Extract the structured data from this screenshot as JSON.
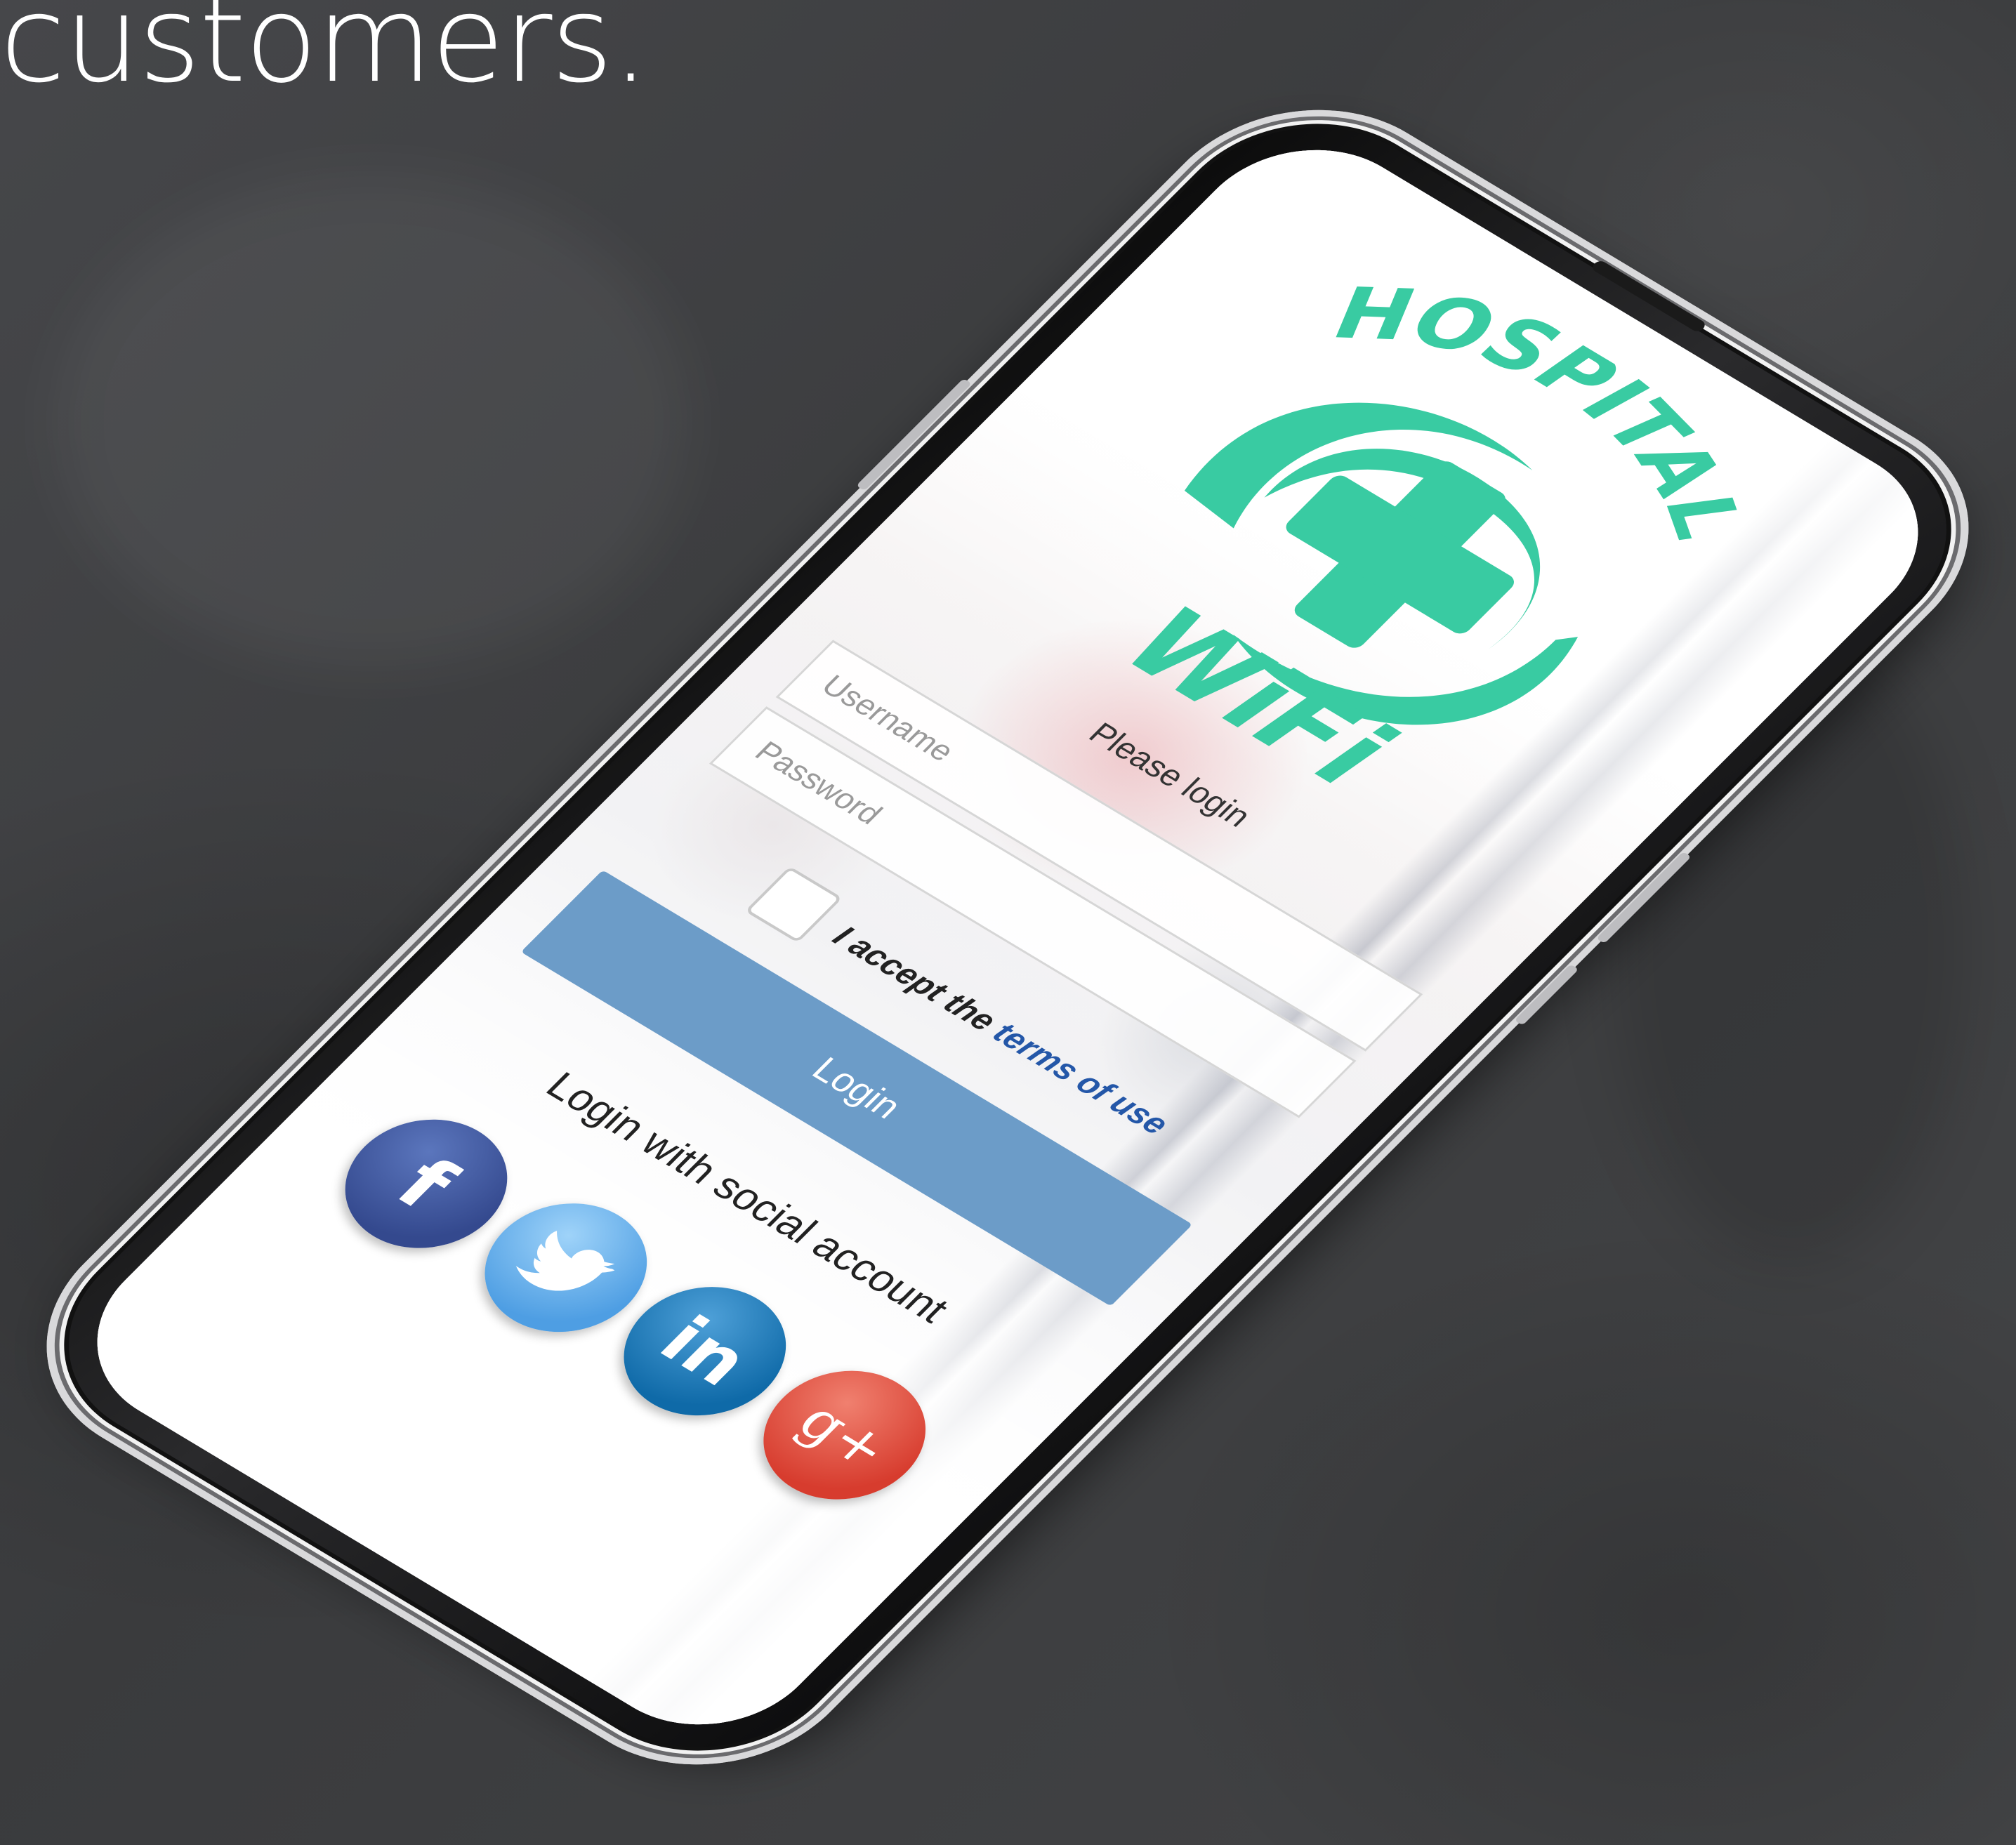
{
  "headline": "customers.",
  "login_screen": {
    "logo": {
      "top_word": "HOSPITAL",
      "bottom_word": "WiFi",
      "icon": "medical-cross-icon"
    },
    "prompt": "Please login",
    "username_placeholder": "Username",
    "password_placeholder": "Password",
    "terms": {
      "prefix": "I accept the",
      "link": "terms of use",
      "checked": false
    },
    "login_button": "Login",
    "social_title": "Login with social account",
    "social_buttons": [
      {
        "name": "facebook",
        "glyph": "f",
        "icon": "facebook-icon"
      },
      {
        "name": "twitter",
        "glyph": "",
        "icon": "twitter-bird-icon"
      },
      {
        "name": "linkedin",
        "glyph": "in",
        "icon": "linkedin-icon"
      },
      {
        "name": "google-plus",
        "glyph": "g+",
        "icon": "google-plus-icon"
      }
    ]
  },
  "colors": {
    "brand_green": "#39cba2",
    "login_button": "#6c9cc8",
    "terms_link": "#2457a8",
    "background": "#3c3d3f"
  }
}
